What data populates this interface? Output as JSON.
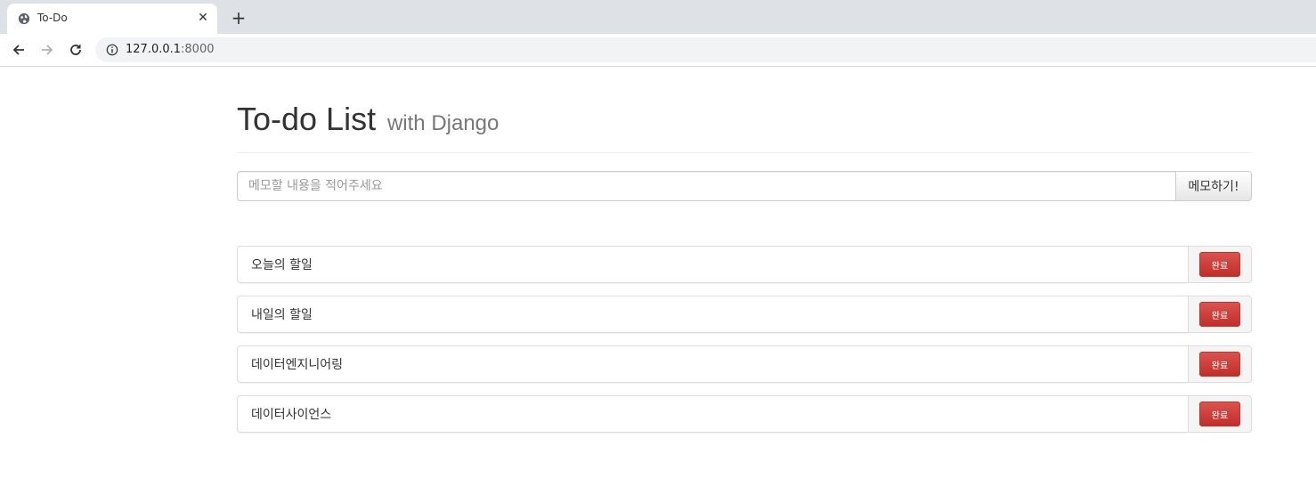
{
  "browser": {
    "tab_title": "To-Do",
    "url_host": "127.0.0.1",
    "url_port": ":8000"
  },
  "page": {
    "title": "To-do List",
    "subtitle": "with Django",
    "input_placeholder": "메모할 내용을 적어주세요",
    "submit_label": "메모하기!"
  },
  "todos": [
    {
      "text": "오늘의 할일",
      "action": "완료"
    },
    {
      "text": "내일의 할일",
      "action": "완료"
    },
    {
      "text": "데이터엔지니어링",
      "action": "완료"
    },
    {
      "text": "데이터사이언스",
      "action": "완료"
    }
  ],
  "colors": {
    "danger": "#d9534f",
    "tabstrip": "#dee1e6"
  }
}
